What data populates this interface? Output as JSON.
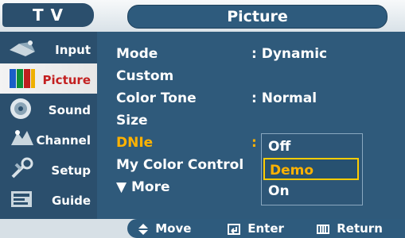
{
  "header": {
    "tv_label": "T V",
    "title": "Picture"
  },
  "sidebar": {
    "items": [
      {
        "label": "Input",
        "icon": "input-icon"
      },
      {
        "label": "Picture",
        "icon": "picture-icon",
        "active": true
      },
      {
        "label": "Sound",
        "icon": "sound-icon"
      },
      {
        "label": "Channel",
        "icon": "channel-icon"
      },
      {
        "label": "Setup",
        "icon": "setup-icon"
      },
      {
        "label": "Guide",
        "icon": "guide-icon"
      }
    ]
  },
  "menu": {
    "rows": [
      {
        "label": "Mode",
        "value": ": Dynamic"
      },
      {
        "label": "Custom",
        "value": ""
      },
      {
        "label": "Color Tone",
        "value": ": Normal"
      },
      {
        "label": "Size",
        "value": ""
      },
      {
        "label": "DNIe",
        "value": ":",
        "highlight": true
      },
      {
        "label": "My Color Control",
        "value": ""
      },
      {
        "label": "▼ More",
        "value": ""
      }
    ],
    "dropdown": {
      "options": [
        "Off",
        "Demo",
        "On"
      ],
      "selected": "Demo"
    }
  },
  "footer": {
    "move": "Move",
    "enter": "Enter",
    "return": "Return"
  },
  "colors": {
    "panel": "#2f5a7b",
    "sidebar": "#2b4f6d",
    "highlight": "#ffb200",
    "selection_border": "#ffcc00"
  }
}
